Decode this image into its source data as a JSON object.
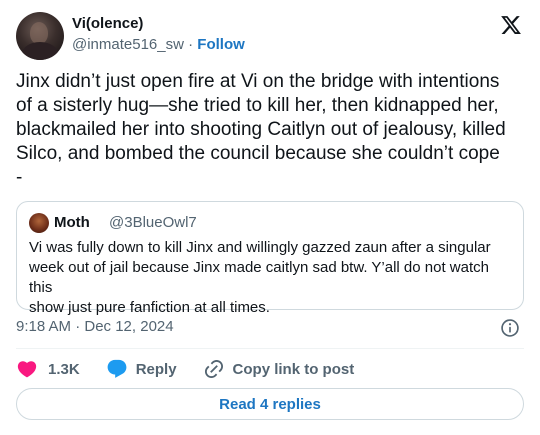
{
  "author": {
    "display_name": "Vi(olence)",
    "handle": "@inmate516_sw",
    "separator": "·",
    "follow_label": "Follow"
  },
  "tweet": {
    "text_line1": "Jinx didn’t just open fire at Vi on the bridge with intentions",
    "text_line2": "of a sisterly hug—she tried to kill her, then kidnapped her,",
    "text_line3": "blackmailed her into shooting Caitlyn out of jealousy, killed",
    "text_line4": "Silco, and bombed the council because she couldn’t cope",
    "text_line5": "-"
  },
  "quote": {
    "name": "Moth",
    "handle": "@3BlueOwl7",
    "text_line1": "Vi was fully down to kill Jinx and willingly gazzed zaun after a singular",
    "text_line2": "week out of jail because Jinx made caitlyn sad btw. Y’all do not watch this",
    "text_line3": "show just pure fanfiction at all times."
  },
  "meta": {
    "timestamp": "9:18 AM · Dec 12, 2024"
  },
  "actions": {
    "likes": "1.3K",
    "reply_label": "Reply",
    "copy_label": "Copy link to post",
    "read_replies_label": "Read 4 replies"
  },
  "colors": {
    "link_blue": "#1d76c2",
    "heart_pink": "#f91880",
    "reply_blue": "#1d9bf0",
    "muted_gray": "#536471"
  }
}
